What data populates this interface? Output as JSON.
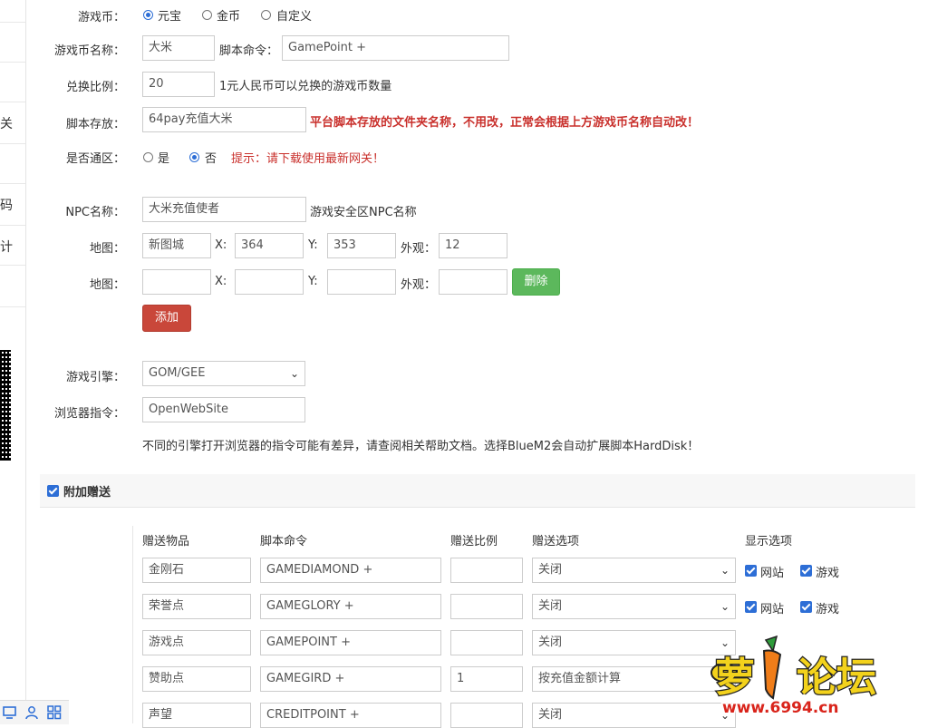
{
  "sidebar": {
    "glyphs": [
      "关",
      "码",
      "计"
    ]
  },
  "currency": {
    "label": "游戏币：",
    "options": [
      {
        "label": "元宝",
        "checked": true
      },
      {
        "label": "金币",
        "checked": false
      },
      {
        "label": "自定义",
        "checked": false
      }
    ]
  },
  "currency_name": {
    "label": "游戏币名称：",
    "value": "大米",
    "script_label": "脚本命令：",
    "script_value": "GamePoint +"
  },
  "ratio": {
    "label": "兑换比例：",
    "value": "20",
    "hint": "1元人民币可以兑换的游戏币数量"
  },
  "script_store": {
    "label": "脚本存放：",
    "value": "64pay充值大米",
    "hint": "平台脚本存放的文件夹名称，不用改，正常会根据上方游戏币名称自动改！"
  },
  "universal": {
    "label": "是否通区：",
    "yes": "是",
    "no": "否",
    "selected": "否",
    "tip": "提示：请下载使用最新网关！"
  },
  "npc": {
    "label": "NPC名称：",
    "value": "大米充值使者",
    "hint": "游戏安全区NPC名称",
    "map_label": "地图：",
    "x_label": "X:",
    "y_label": "Y:",
    "look_label": "外观：",
    "rows": [
      {
        "map": "新图城",
        "x": "364",
        "y": "353",
        "look": "12"
      },
      {
        "map": "",
        "x": "",
        "y": "",
        "look": ""
      }
    ],
    "delete_label": "删除",
    "add_label": "添加"
  },
  "engine": {
    "label": "游戏引擎：",
    "value": "GOM/GEE"
  },
  "browser": {
    "label": "浏览器指令：",
    "value": "OpenWebSite",
    "note": "不同的引擎打开浏览器的指令可能有差异，请查阅相关帮助文档。选择BlueM2会自动扩展脚本HardDisk！"
  },
  "bonus": {
    "section_label": "附加赠送",
    "checked": true,
    "headers": {
      "item": "赠送物品",
      "script": "脚本命令",
      "ratio": "赠送比例",
      "option": "赠送选项",
      "display": "显示选项"
    },
    "site_label": "网站",
    "game_label": "游戏",
    "rows": [
      {
        "item": "金刚石",
        "script": "GAMEDIAMOND +",
        "ratio": "",
        "option": "关闭"
      },
      {
        "item": "荣誉点",
        "script": "GAMEGLORY +",
        "ratio": "",
        "option": "关闭"
      },
      {
        "item": "游戏点",
        "script": "GAMEPOINT +",
        "ratio": "",
        "option": "关闭"
      },
      {
        "item": "赞助点",
        "script": "GAMEGIRD +",
        "ratio": "1",
        "option": "按充值金额计算"
      },
      {
        "item": "声望",
        "script": "CREDITPOINT +",
        "ratio": "",
        "option": "关闭"
      }
    ]
  },
  "watermark": {
    "brand": "萝卜论坛",
    "url": "www.6994.cn"
  },
  "colors": {
    "accent": "#2d6ed6",
    "danger": "#c9302c",
    "success": "#5cb85c",
    "add": "#c9473a"
  }
}
